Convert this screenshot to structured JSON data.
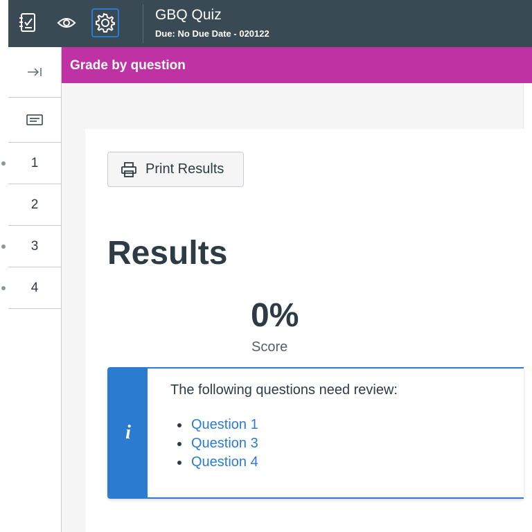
{
  "header": {
    "quiz_title": "GBQ Quiz",
    "due_text": "Due: No Due Date - 020122",
    "icons": [
      "checklist-icon",
      "eye-icon",
      "gear-icon"
    ]
  },
  "grade_bar": {
    "label": "Grade by question"
  },
  "left_nav": {
    "collapse_icon": "arrow-to-right-icon",
    "summary_icon": "summary-card-icon",
    "questions": [
      {
        "label": "1",
        "flagged": true
      },
      {
        "label": "2",
        "flagged": false
      },
      {
        "label": "3",
        "flagged": true
      },
      {
        "label": "4",
        "flagged": true
      }
    ]
  },
  "main": {
    "print_button": "Print Results",
    "results_title": "Results",
    "score_value": "0%",
    "score_label": "Score",
    "review": {
      "message": "The following questions need review:",
      "icon_letter": "i",
      "questions": [
        "Question 1",
        "Question 3",
        "Question 4"
      ]
    }
  },
  "colors": {
    "header_bg": "#3a4a55",
    "accent_magenta": "#bf32a4",
    "info_blue": "#2b7bd0",
    "text": "#2d3b45"
  }
}
